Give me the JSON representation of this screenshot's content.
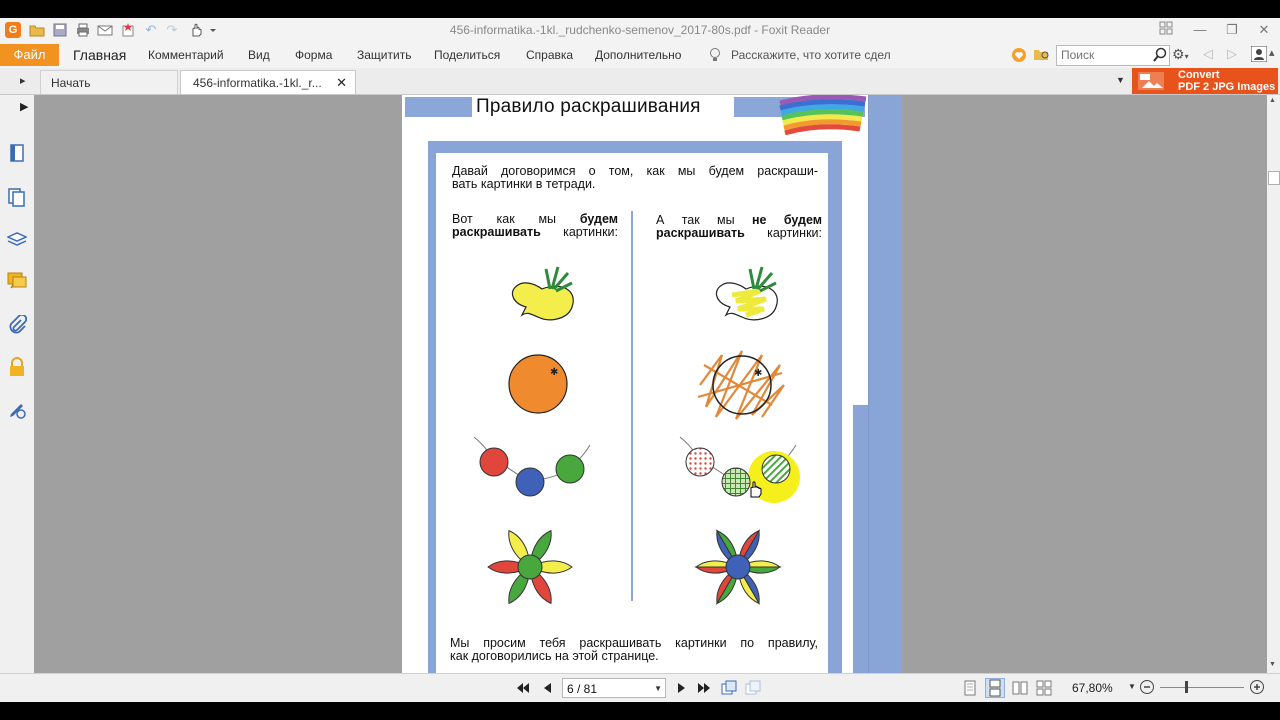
{
  "window": {
    "title": "456-informatika.-1kl._rudchenko-semenov_2017-80s.pdf - Foxit Reader"
  },
  "menu": {
    "file": "Файл",
    "items": [
      "Главная",
      "Комментарий",
      "Вид",
      "Форма",
      "Защитить",
      "Поделиться",
      "Справка",
      "Дополнительно"
    ],
    "tell_me": "Расскажите, что хотите сдел",
    "search_placeholder": "Поиск"
  },
  "tabs": [
    {
      "label": "Начать"
    },
    {
      "label": "456-informatika.-1kl._r..."
    }
  ],
  "convert_banner": {
    "line1": "Convert",
    "line2": "PDF 2 JPG Images"
  },
  "page_content": {
    "title": "Правило раскрашивания",
    "intro_line1": "Давай договоримся о том, как мы будем раскраши-",
    "intro_line2": "вать картинки в тетради.",
    "left_heading": {
      "pre": "Вот как мы ",
      "bold1": "будем",
      "bold2": "раскрашивать",
      "post": " картинки:"
    },
    "right_heading": {
      "pre": "А так мы ",
      "bold1": "не будем",
      "bold2": "раскрашивать",
      "post": " картинки:"
    },
    "footer_line1": "Мы просим тебя раскрашивать картинки по правилу,",
    "footer_line2": "как договорились на этой странице."
  },
  "statusbar": {
    "page_indicator": "6 / 81",
    "zoom": "67,80%"
  },
  "colors": {
    "accent_orange": "#f29220",
    "convert_red": "#e8531b",
    "page_blue": "#89a5d7",
    "doc_background": "#a0a0a0"
  }
}
